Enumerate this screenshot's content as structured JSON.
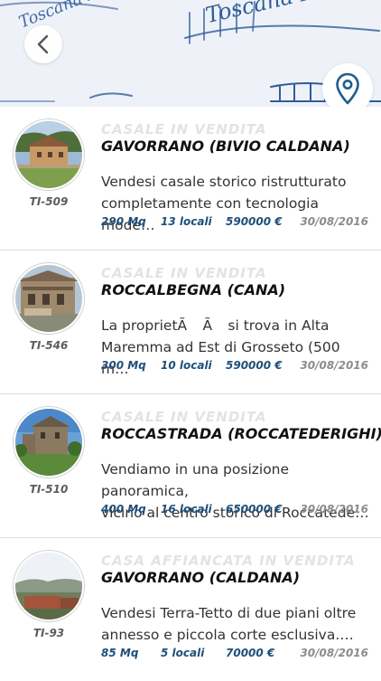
{
  "header": {
    "brand_main": "Toscana Immobili",
    "brand_left": "Toscana Immobili"
  },
  "listings": [
    {
      "type": "CASALE IN VENDITA",
      "title": "GAVORRANO (BIVIO CALDANA)",
      "desc_line1": "Vendesi casale storico ristrutturato",
      "desc_line2": "completamente con tecnologia mode…",
      "code": "TI-509",
      "mq": "290 Mq",
      "locali": "13 locali",
      "price": "590000 €",
      "date": "30/08/2016"
    },
    {
      "type": "CASALE IN VENDITA",
      "title": "ROCCALBEGNA (CANA)",
      "desc_line1": "La proprietÃ Ã si trova in Alta",
      "desc_line2": "Maremma ad Est di Grosseto (500 m…",
      "code": "TI-546",
      "mq": "300 Mq",
      "locali": "10 locali",
      "price": "590000 €",
      "date": "30/08/2016"
    },
    {
      "type": "CASALE IN VENDITA",
      "title": "ROCCASTRADA (ROCCATEDERIGHI)",
      "desc_line1": "Vendiamo in una posizione panoramica,",
      "desc_line2": "vicino al centro storico di Roccatede…",
      "code": "TI-510",
      "mq": "400 Mq",
      "locali": "16 locali",
      "price": "650000 €",
      "date": "30/08/2016"
    },
    {
      "type": "CASA AFFIANCATA IN VENDITA",
      "title": "GAVORRANO (CALDANA)",
      "desc_line1": "Vendesi Terra-Tetto di due piani oltre",
      "desc_line2": "annesso e piccola corte esclusiva.…",
      "code": "TI-93",
      "mq": "85 Mq",
      "locali": "5 locali",
      "price": "70000 €",
      "date": "30/08/2016"
    }
  ],
  "icons": {
    "back": "chevron-left-icon",
    "map": "map-pin-icon"
  },
  "colors": {
    "accent": "#1e4f7a",
    "brand": "#2f5d9a",
    "header_bg": "#eef2f8"
  }
}
